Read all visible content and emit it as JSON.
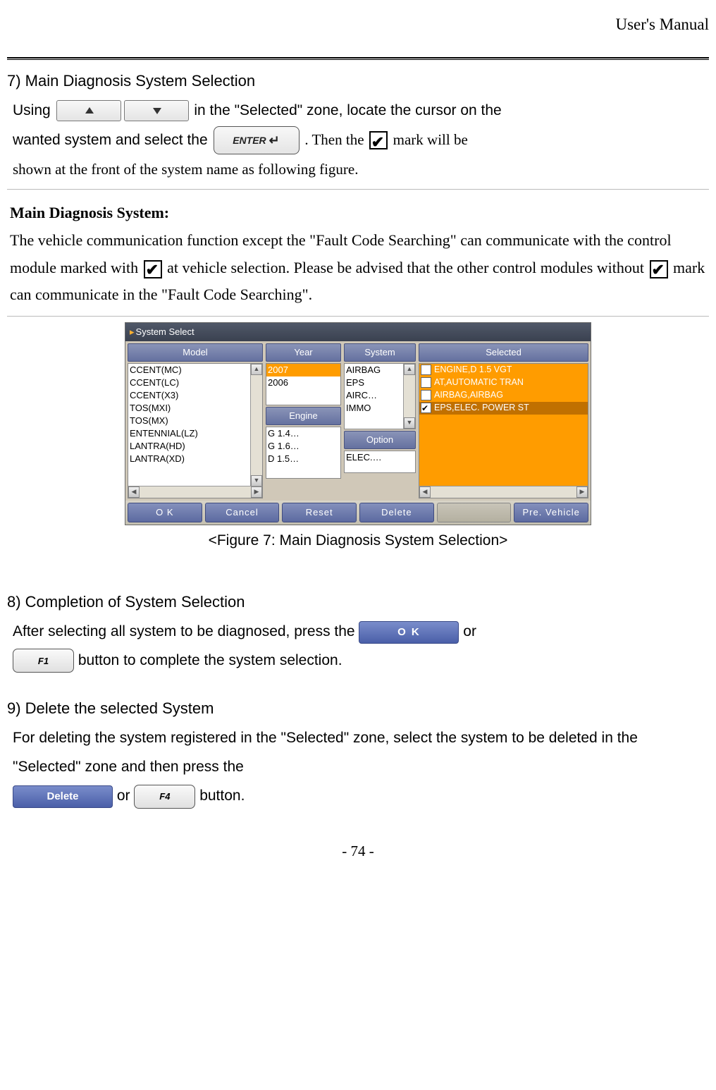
{
  "header": {
    "title": "User's Manual"
  },
  "section7": {
    "title": "7) Main Diagnosis System Selection",
    "line1a": "Using ",
    "line1b": " in the \"Selected\" zone, locate the cursor on the",
    "line2a": "wanted system and select the ",
    "line2b": ". Then the ",
    "line2c": " mark will be",
    "line3": "shown at the front of the system name as following figure.",
    "enter_label": "ENTER"
  },
  "mds": {
    "title": "Main Diagnosis System:",
    "p1a": "The vehicle communication function except the \"Fault Code Searching\" can communicate with the control module marked with ",
    "p1b": " at vehicle selection. Please be advised that the other control modules without ",
    "p1c": " mark can communicate in the \"Fault Code Searching\"."
  },
  "screenshot": {
    "title": "System Select",
    "headers": {
      "model": "Model",
      "year": "Year",
      "system": "System",
      "selected": "Selected",
      "engine": "Engine",
      "option": "Option"
    },
    "models": [
      "CCENT(MC)",
      "CCENT(LC)",
      "CCENT(X3)",
      "TOS(MXI)",
      "TOS(MX)",
      "ENTENNIAL(LZ)",
      "LANTRA(HD)",
      "LANTRA(XD)"
    ],
    "years": [
      "2007",
      "2006"
    ],
    "systems": [
      "AIRBAG",
      "EPS",
      "AIRC…",
      "IMMO"
    ],
    "engines": [
      "G 1.4…",
      "G 1.6…",
      "D 1.5…"
    ],
    "options": [
      "ELEC.…"
    ],
    "selected": [
      {
        "label": "ENGINE,D 1.5 VGT",
        "checked": false
      },
      {
        "label": "AT,AUTOMATIC TRAN",
        "checked": false
      },
      {
        "label": "AIRBAG,AIRBAG",
        "checked": false
      },
      {
        "label": "EPS,ELEC. POWER ST",
        "checked": true
      }
    ],
    "buttons": [
      "O K",
      "Cancel",
      "Reset",
      "Delete",
      "",
      "Pre. Vehicle"
    ]
  },
  "caption": "<Figure 7: Main Diagnosis System Selection>",
  "section8": {
    "title": "8) Completion of System Selection",
    "line1a": "After selecting all system to be diagnosed, press the ",
    "line1b": " or",
    "line2a": " button to complete the system selection.",
    "ok_label": "O K",
    "f1_label": "F1"
  },
  "section9": {
    "title": "9) Delete the selected System",
    "line1": "For deleting the system registered in the \"Selected\" zone, select the system to be deleted in the \"Selected\" zone and then press the",
    "line2a": " or ",
    "line2b": " button.",
    "delete_label": "Delete",
    "f4_label": "F4"
  },
  "page_number": "- 74 -"
}
